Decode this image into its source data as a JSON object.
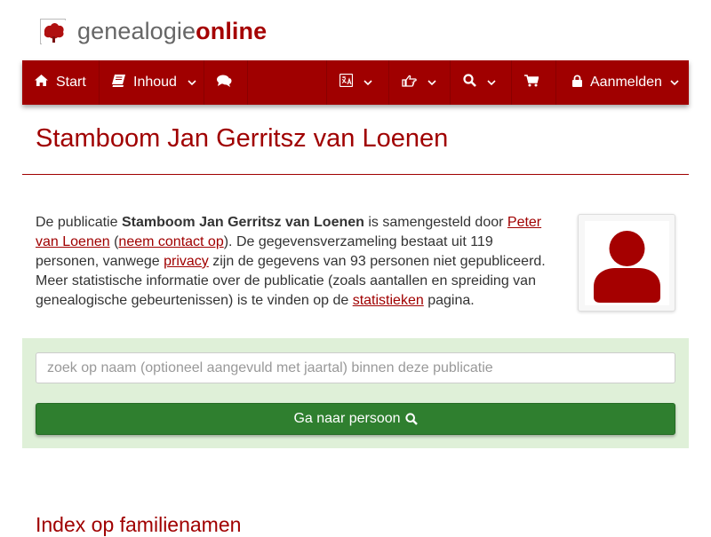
{
  "brand": {
    "prefix": "genealogie",
    "suffix": "online"
  },
  "nav": {
    "start": "Start",
    "inhoud": "Inhoud",
    "aanmelden": "Aanmelden"
  },
  "page_title": "Stamboom Jan Gerritsz van Loenen",
  "intro": {
    "p1": "De publicatie ",
    "title_bold": "Stamboom Jan Gerritsz van Loenen",
    "p2": " is samengesteld door ",
    "author_link": "Peter van Loenen",
    "p3": " (",
    "contact_link": "neem contact op",
    "p4": "). De gegevensverzameling bestaat uit 119 personen, vanwege ",
    "privacy_link": "privacy",
    "p5": " zijn de gegevens van 93 personen niet gepubliceerd. Meer statistische informatie over de publicatie (zoals aantallen en spreiding van genealogische gebeurtenissen) is te vinden op de ",
    "stats_link": "statistieken",
    "p6": " pagina."
  },
  "search": {
    "placeholder": "zoek op naam (optioneel aangevuld met jaartal) binnen deze publicatie",
    "button_label": "Ga naar persoon"
  },
  "section_heading": "Index op familienamen",
  "colors": {
    "brand_red": "#a00000",
    "panel_green": "#dff0d8",
    "button_green": "#2f7f2f"
  }
}
